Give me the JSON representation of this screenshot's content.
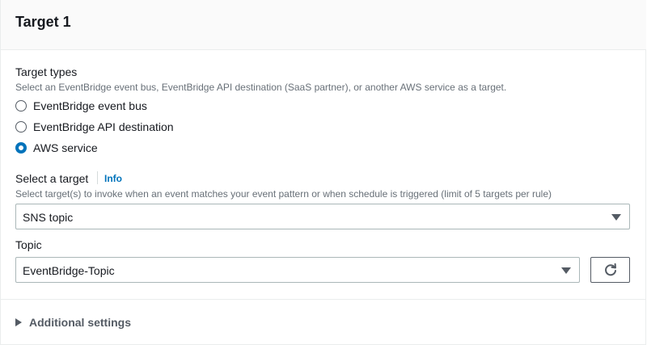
{
  "panel": {
    "title": "Target 1"
  },
  "target_types": {
    "label": "Target types",
    "description": "Select an EventBridge event bus, EventBridge API destination (SaaS partner), or another AWS service as a target.",
    "options": [
      {
        "label": "EventBridge event bus",
        "selected": false
      },
      {
        "label": "EventBridge API destination",
        "selected": false
      },
      {
        "label": "AWS service",
        "selected": true
      }
    ]
  },
  "select_target": {
    "label": "Select a target",
    "info_link": "Info",
    "description": "Select target(s) to invoke when an event matches your event pattern or when schedule is triggered (limit of 5 targets per rule)",
    "value": "SNS topic"
  },
  "topic": {
    "label": "Topic",
    "value": "EventBridge-Topic"
  },
  "additional_settings": {
    "label": "Additional settings",
    "expanded": false
  },
  "icons": {
    "dropdown": "caret-down-icon",
    "refresh": "refresh-icon",
    "expand": "caret-right-icon"
  },
  "colors": {
    "accent": "#0073bb",
    "text": "#16191f",
    "secondary_text": "#687078",
    "header_bg": "#fafafa"
  }
}
